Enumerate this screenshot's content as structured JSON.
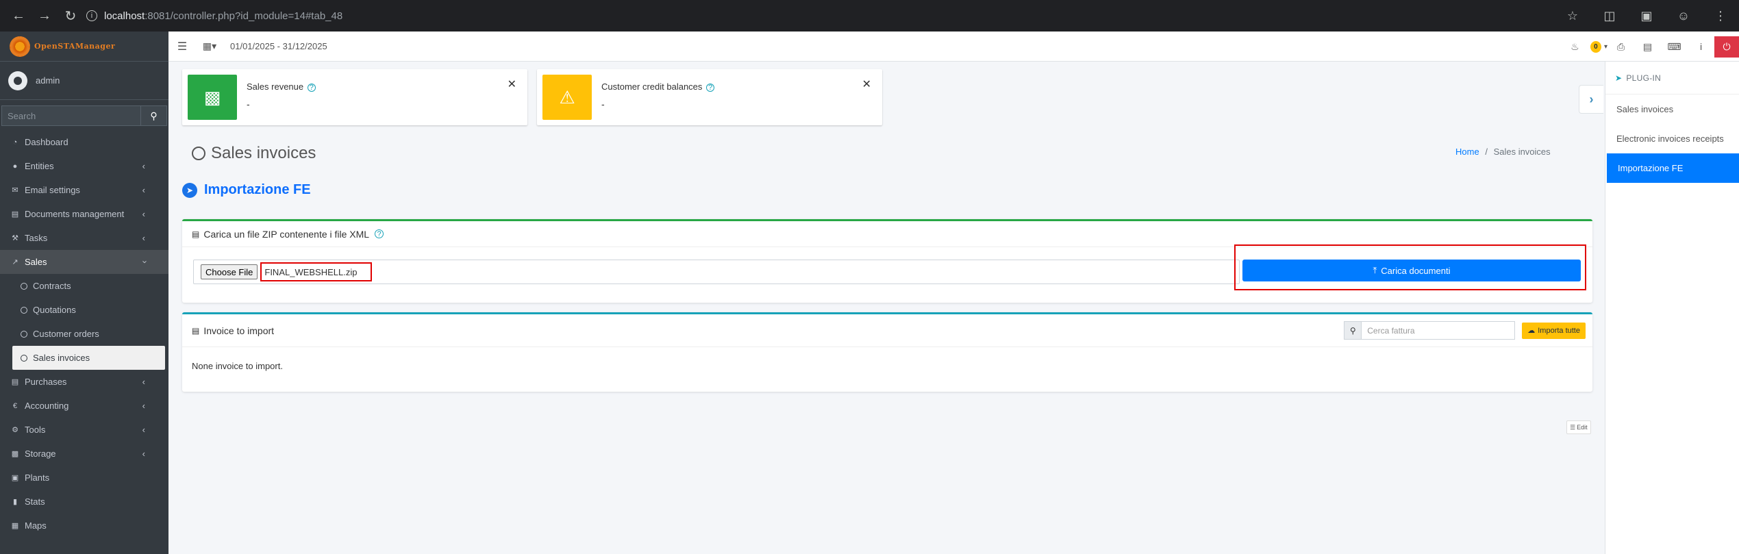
{
  "browser": {
    "url_host": "localhost",
    "url_path": ":8081/controller.php?id_module=14#tab_48"
  },
  "brand": {
    "logo_text": "OpenSTAManager"
  },
  "user": {
    "name": "admin"
  },
  "sidebar": {
    "search_placeholder": "Search",
    "items": [
      {
        "label": "Dashboard",
        "icon": "dashboard-icon"
      },
      {
        "label": "Entities",
        "icon": "users-icon"
      },
      {
        "label": "Email settings",
        "icon": "envelope-icon"
      },
      {
        "label": "Documents management",
        "icon": "folder-icon"
      },
      {
        "label": "Tasks",
        "icon": "wrench-icon"
      },
      {
        "label": "Sales",
        "icon": "chart-icon"
      },
      {
        "label": "Contracts"
      },
      {
        "label": "Quotations"
      },
      {
        "label": "Customer orders"
      },
      {
        "label": "Sales invoices"
      },
      {
        "label": "Purchases",
        "icon": "cart-icon"
      },
      {
        "label": "Accounting",
        "icon": "euro-icon"
      },
      {
        "label": "Tools",
        "icon": "cog-icon"
      },
      {
        "label": "Storage",
        "icon": "truck-icon"
      },
      {
        "label": "Plants",
        "icon": "plant-icon"
      },
      {
        "label": "Stats",
        "icon": "bar-chart-icon"
      },
      {
        "label": "Maps",
        "icon": "map-icon"
      }
    ]
  },
  "topbar": {
    "period": "01/01/2025 - 31/12/2025",
    "notifications_count": "0"
  },
  "info_boxes": [
    {
      "title": "Sales revenue",
      "value": "-",
      "color": "#28a745"
    },
    {
      "title": "Customer credit balances",
      "value": "-",
      "color": "#ffc107"
    }
  ],
  "content": {
    "module_title": "Sales invoices",
    "breadcrumb_home": "Home",
    "breadcrumb_sep": "/",
    "breadcrumb_current": "Sales invoices",
    "plugin_title": "Importazione FE"
  },
  "upload_card": {
    "title": "Carica un file ZIP contenente i file XML",
    "choose_label": "Choose File",
    "file_name": "FINAL_WEBSHELL.zip",
    "upload_label": "Carica documenti"
  },
  "import_card": {
    "title": "Invoice to import",
    "search_placeholder": "Cerca fattura",
    "import_all_label": "Importa tutte",
    "empty_text": "None invoice to import."
  },
  "edit_label": "Edit",
  "right_panel": {
    "header": "PLUG-IN",
    "items": [
      "Sales invoices",
      "Electronic invoices receipts",
      "Importazione FE"
    ]
  }
}
